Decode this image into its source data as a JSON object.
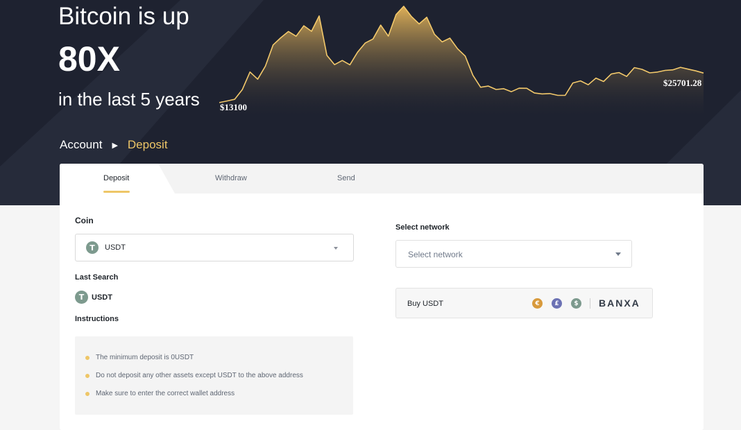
{
  "hero": {
    "title": "Bitcoin is up",
    "multiplier": "80X",
    "subtitle": "in the last 5 years"
  },
  "chart_data": {
    "type": "area",
    "start_label": "$13100",
    "end_label": "$25701.28",
    "values": [
      13100,
      13600,
      14100,
      16500,
      20800,
      19200,
      22400,
      26800,
      28600,
      30200,
      29200,
      31800,
      30600,
      33600,
      24400,
      22300,
      23400,
      22500,
      25600,
      27900,
      28200,
      31600,
      29100,
      34300,
      36400,
      34100,
      31700,
      33400,
      29500,
      27800,
      28800,
      26400,
      24800,
      19600,
      16900,
      17300,
      16600,
      16900,
      16300,
      16500,
      16600,
      15600,
      15500,
      15700,
      15400,
      15500,
      17800,
      18400,
      17600,
      19300,
      18600,
      20500,
      20200,
      19400,
      21600,
      21300,
      20600,
      20900,
      21400,
      20900,
      21600,
      21300,
      21000,
      20600
    ],
    "color": "#f3c96b"
  },
  "breadcrumb": {
    "parent": "Account",
    "current": "Deposit"
  },
  "tabs": {
    "deposit": "Deposit",
    "withdraw": "Withdraw",
    "send": "Send"
  },
  "form": {
    "coin_label": "Coin",
    "coin_value": "USDT",
    "coin_icon": "T",
    "last_search_label": "Last Search",
    "last_search_value": "USDT",
    "instructions_label": "Instructions",
    "network_label": "Select network",
    "network_placeholder": "Select network"
  },
  "instructions": [
    "The minimum deposit is 0USDT",
    "Do not deposit any other assets except USDT to the above address",
    "Make sure to enter the correct wallet address"
  ],
  "buy": {
    "label": "Buy USDT",
    "euro": "€",
    "pound": "£",
    "dollar": "$",
    "provider": "BANXA"
  },
  "colors": {
    "accent": "#eec667",
    "hero_bg": "#1e2230",
    "euro": "#d89a3c",
    "pound": "#6c72b4",
    "dollar": "#7d9a8e"
  }
}
